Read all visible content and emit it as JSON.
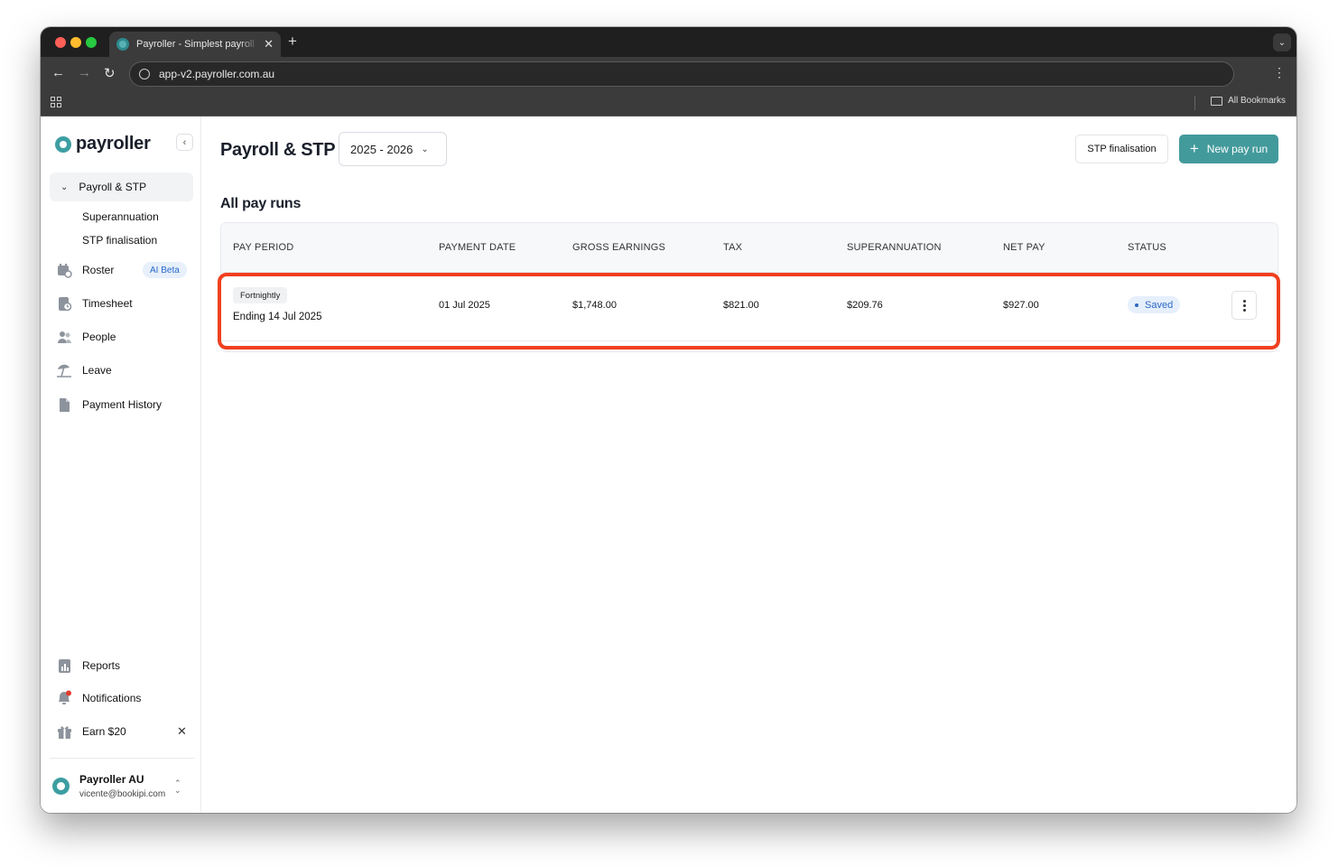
{
  "browser": {
    "tab_title": "Payroller - Simplest payroll software",
    "url": "app-v2.payroller.com.au",
    "bookmarks_label": "All Bookmarks"
  },
  "sidebar": {
    "logo_text": "payroller",
    "group_label": "Payroll & STP",
    "sub_items": [
      "Superannuation",
      "STP finalisation"
    ],
    "items": [
      {
        "label": "Roster",
        "icon": "roster-icon"
      },
      {
        "label": "Timesheet",
        "icon": "timesheet-icon"
      },
      {
        "label": "People",
        "icon": "people-icon"
      },
      {
        "label": "Leave",
        "icon": "leave-icon"
      },
      {
        "label": "Payment History",
        "icon": "document-icon"
      }
    ],
    "ai_badge": "AI Beta",
    "bottom_items": [
      {
        "label": "Reports",
        "icon": "reports-icon"
      },
      {
        "label": "Notifications",
        "icon": "bell-icon"
      },
      {
        "label": "Earn $20",
        "icon": "gift-icon"
      }
    ],
    "account": {
      "name": "Payroller AU",
      "email": "vicente@bookipi.com"
    }
  },
  "header": {
    "title": "Payroll & STP",
    "year_select": "2025 - 2026",
    "stp_button": "STP finalisation",
    "new_button": "New pay run"
  },
  "section_title": "All pay runs",
  "table": {
    "columns": [
      "PAY PERIOD",
      "PAYMENT DATE",
      "GROSS EARNINGS",
      "TAX",
      "SUPERANNUATION",
      "NET PAY",
      "STATUS"
    ],
    "rows": [
      {
        "frequency": "Fortnightly",
        "period": "Ending 14 Jul 2025",
        "payment_date": "01 Jul 2025",
        "gross": "$1,748.00",
        "tax": "$821.00",
        "super": "$209.76",
        "net": "$927.00",
        "status": "Saved"
      }
    ]
  },
  "colors": {
    "accent": "#439a9b",
    "highlight": "#f0401f",
    "status_blue": "#2c68c3"
  }
}
